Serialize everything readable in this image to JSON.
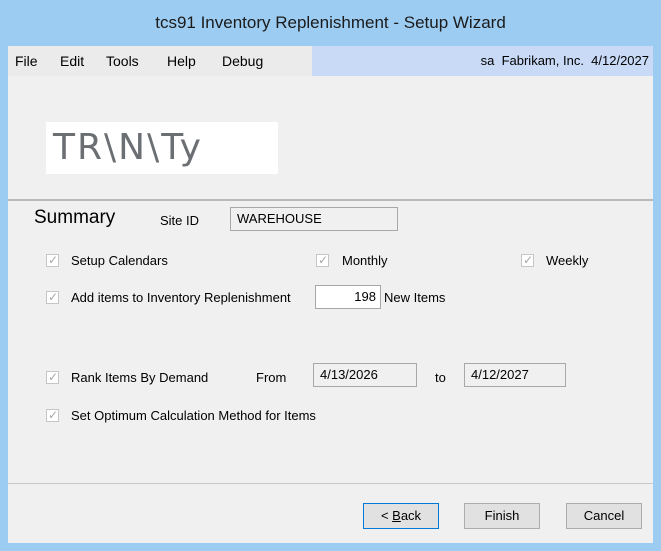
{
  "window": {
    "title": "tcs91 Inventory Replenishment - Setup  Wizard"
  },
  "menu": {
    "items": [
      "File",
      "Edit",
      "Tools",
      "Help",
      "Debug"
    ],
    "status": "sa  Fabrikam, Inc.  4/12/2027"
  },
  "banner": {
    "logo_text": "TR\\N\\Ty"
  },
  "summary": {
    "title": "Summary",
    "site_id_label": "Site ID",
    "site_id_value": "WAREHOUSE",
    "setup_calendars_label": "Setup Calendars",
    "monthly_label": "Monthly",
    "weekly_label": "Weekly",
    "add_items_label": "Add items to Inventory Replenishment",
    "new_items_count": "198",
    "new_items_label": "New Items",
    "rank_items_label": "Rank Items By Demand",
    "from_label": "From",
    "from_date": "4/13/2026",
    "to_label": "to",
    "to_date": "4/12/2027",
    "optimum_label": "Set Optimum Calculation Method for Items"
  },
  "buttons": {
    "back_prefix": "< ",
    "back_accel": "B",
    "back_rest": "ack",
    "finish": "Finish",
    "cancel": "Cancel"
  },
  "colors": {
    "title_bar": "#9cccf2",
    "menu_status_bg": "#c9daf7",
    "panel_bg": "#f0f0f0"
  }
}
